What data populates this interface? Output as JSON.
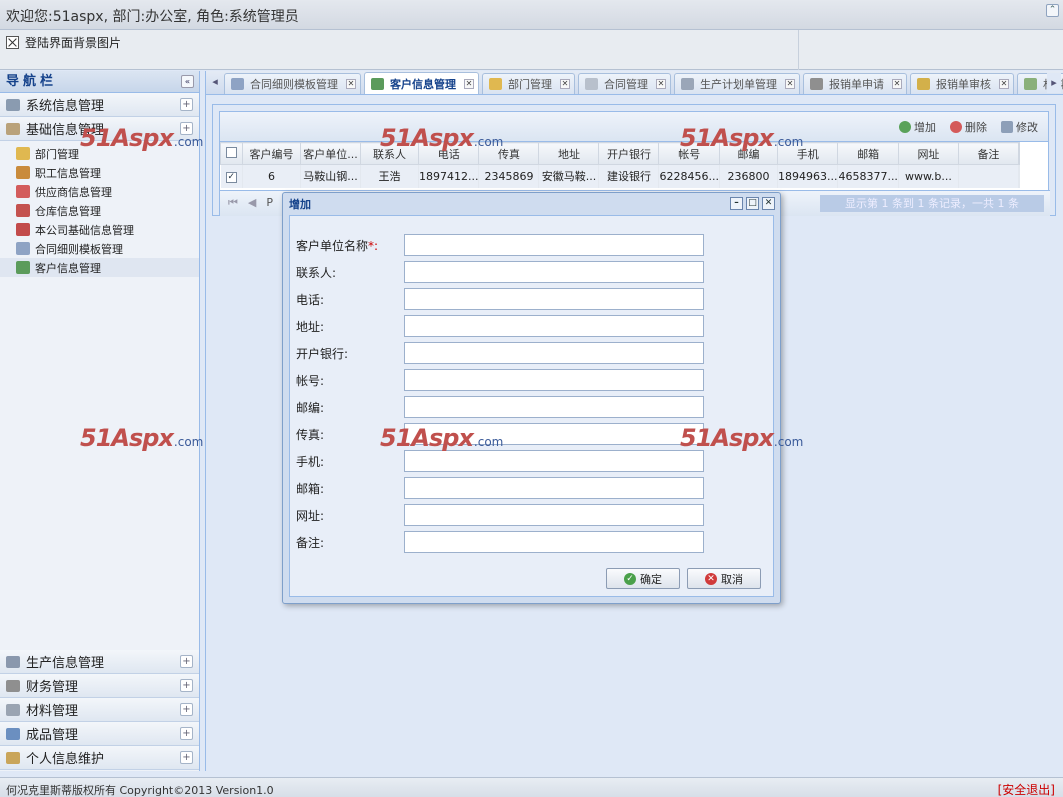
{
  "header": {
    "welcome": "欢迎您:51aspx,     部门:办公室,     角色:系统管理员",
    "banner_image_alt": "登陆界面背景图片"
  },
  "sidebar": {
    "title": "导航栏",
    "sections_top": [
      {
        "label": "系统信息管理",
        "icon": "computer-icon",
        "color": "#8a9bb0"
      },
      {
        "label": "基础信息管理",
        "icon": "folder-icon",
        "color": "#b9a27a"
      }
    ],
    "tree": [
      {
        "label": "部门管理",
        "icon": "box-icon",
        "color": "#e0b850"
      },
      {
        "label": "职工信息管理",
        "icon": "user-icon",
        "color": "#c98b3c"
      },
      {
        "label": "供应商信息管理",
        "icon": "heart-icon",
        "color": "#d35c5c"
      },
      {
        "label": "仓库信息管理",
        "icon": "warehouse-icon",
        "color": "#c4524f"
      },
      {
        "label": "本公司基础信息管理",
        "icon": "flag-icon",
        "color": "#c24b4b"
      },
      {
        "label": "合同细则模板管理",
        "icon": "table-icon",
        "color": "#8ea3c4"
      },
      {
        "label": "客户信息管理",
        "icon": "customer-icon",
        "color": "#5b9b5b"
      }
    ],
    "sections_bottom": [
      {
        "label": "生产信息管理",
        "icon": "truck-icon",
        "color": "#8a98ad"
      },
      {
        "label": "财务管理",
        "icon": "stamp-icon",
        "color": "#8f8f8f"
      },
      {
        "label": "材料管理",
        "icon": "wrench-icon",
        "color": "#9aa4b2"
      },
      {
        "label": "成品管理",
        "icon": "pen-icon",
        "color": "#6b8fc0"
      },
      {
        "label": "个人信息维护",
        "icon": "gear-icon",
        "color": "#c9a55a"
      }
    ]
  },
  "tabs": [
    {
      "label": "合同细则模板管理",
      "icon": "table-icon",
      "color": "#8ea3c4",
      "active": false
    },
    {
      "label": "客户信息管理",
      "icon": "customer-icon",
      "color": "#5b9b5b",
      "active": true
    },
    {
      "label": "部门管理",
      "icon": "box-icon",
      "color": "#e0b850",
      "active": false
    },
    {
      "label": "合同管理",
      "icon": "box-icon",
      "color": "#b8c0cc",
      "active": false
    },
    {
      "label": "生产计划单管理",
      "icon": "doc-icon",
      "color": "#9aa6b8",
      "active": false
    },
    {
      "label": "报销单申请",
      "icon": "stamp-icon",
      "color": "#8f8f8f",
      "active": false
    },
    {
      "label": "报销单审核",
      "icon": "key-icon",
      "color": "#d3b04a",
      "active": false
    },
    {
      "label": "材料入",
      "icon": "download-icon",
      "color": "#8ab07a",
      "active": false
    }
  ],
  "grid": {
    "toolbar": {
      "add": "增加",
      "delete": "删除",
      "edit": "修改"
    },
    "columns": [
      "客户编号",
      "客户单位...",
      "联系人",
      "电话",
      "传真",
      "地址",
      "开户银行",
      "帐号",
      "邮编",
      "手机",
      "邮箱",
      "网址",
      "备注"
    ],
    "rows": [
      [
        "6",
        "马鞍山钢...",
        "王浩",
        "1897412...",
        "2345869",
        "安徽马鞍...",
        "建设银行",
        "6228456...",
        "236800",
        "1894963...",
        "4658377...",
        "www.b...",
        ""
      ]
    ],
    "pager_page": "P",
    "pager_info": "显示第 1 条到 1 条记录，一共 1 条"
  },
  "dialog": {
    "title": "增加",
    "fields": [
      {
        "label": "客户单位名称",
        "required": true,
        "value": ""
      },
      {
        "label": "联系人:",
        "required": false,
        "value": ""
      },
      {
        "label": "电话:",
        "required": false,
        "value": ""
      },
      {
        "label": "地址:",
        "required": false,
        "value": ""
      },
      {
        "label": "开户银行:",
        "required": false,
        "value": ""
      },
      {
        "label": "帐号:",
        "required": false,
        "value": ""
      },
      {
        "label": "邮编:",
        "required": false,
        "value": ""
      },
      {
        "label": "传真:",
        "required": false,
        "value": ""
      },
      {
        "label": "手机:",
        "required": false,
        "value": ""
      },
      {
        "label": "邮箱:",
        "required": false,
        "value": ""
      },
      {
        "label": "网址:",
        "required": false,
        "value": ""
      },
      {
        "label": "备注:",
        "required": false,
        "value": ""
      }
    ],
    "required_mark": "*:",
    "ok": "确定",
    "cancel": "取消"
  },
  "footer": {
    "copyright": "何况克里斯蒂版权所有  Copyright©2013 Version1.0",
    "logout": "[安全退出]"
  },
  "watermark": {
    "main": "51Aspx",
    "suffix": ".com"
  }
}
